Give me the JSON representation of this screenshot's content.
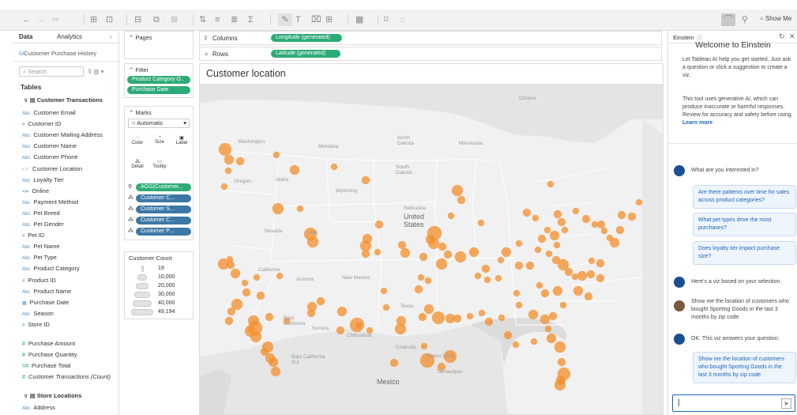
{
  "toolbar": {
    "show_me": "Show Me"
  },
  "data_pane": {
    "tabs": [
      "Data",
      "Analytics"
    ],
    "datasource": "Customer Purchase History",
    "search_placeholder": "Search",
    "tables_heading": "Tables",
    "table1": "Customer Transactions",
    "fields_dim": [
      "Customer Email",
      "Customer ID",
      "Customer Mailing Address",
      "Customer Name",
      "Customer Phone",
      "Customer Location",
      "Loyalty Tier",
      "Online",
      "Payment Method",
      "Pet Breed",
      "Pet Gender",
      "Pet ID",
      "Pet Name",
      "Pet Type",
      "Product Category",
      "Product ID",
      "Product Name",
      "Purchase Date",
      "Season",
      "Store ID"
    ],
    "fields_meas": [
      "Purchase Amount",
      "Purchase Quantity",
      "Purchase Total",
      "Customer Transactions (Count)"
    ],
    "table2": "Store Locations",
    "table2_fields": [
      "Address"
    ]
  },
  "pages": {
    "title": "Pages"
  },
  "filters": {
    "title": "Filter",
    "pills": [
      "Product Category O..",
      "Purchase Date"
    ]
  },
  "marks": {
    "title": "Marks",
    "type": "Automatic",
    "buttons": [
      "Color",
      "Size",
      "Label",
      "Detail",
      "Tooltip"
    ],
    "pills": [
      "AGG(Customer...",
      "Customer C...",
      "Customer S...",
      "Customer C...",
      "Customer P..."
    ]
  },
  "legend": {
    "title": "Customer Count",
    "items": [
      "19",
      "10,000",
      "20,000",
      "30,000",
      "40,000",
      "49,194"
    ]
  },
  "shelves": {
    "columns_label": "Columns",
    "columns_pill": "Longitude (generated)",
    "rows_label": "Rows",
    "rows_pill": "Latitude (generated)"
  },
  "viz": {
    "title": "Customer location",
    "map_labels": {
      "ontario": "Ontario",
      "washington": "Washington",
      "montana": "Montana",
      "north_dakota": "North\nDakota",
      "minnesota": "Minnesota",
      "oregon": "Oregon",
      "idaho": "Idaho",
      "south_dakota": "South\nDakota",
      "wyoming": "Wyoming",
      "nebraska": "Nebraska",
      "nevada": "Nevada",
      "utah": "Utah",
      "united_states": "United\nStates",
      "california": "California",
      "arizona": "Arizona",
      "new_mexico": "New Mexico",
      "texas": "Texas",
      "baja": "Baja\nCalifornia",
      "sonora": "Sonora",
      "chihuahua": "Chihuahua",
      "coahuila": "Coahuila",
      "baja_sur": "Baja California\nSur",
      "mexico": "Mexico",
      "nuevo_leon": "Nuevo Leon",
      "tamaulipas": "Tamaulipas"
    }
  },
  "einstein": {
    "header": "Einstein",
    "welcome": "Welcome to Einstein",
    "intro": "Let Tableau AI help you get started. Just ask a question or click a suggestion to create a viz.",
    "disclaimer": "This tool uses generative AI, which can produce inaccurate or harmful responses. Review for accuracy and safety before using.",
    "learn_more": "Learn more",
    "q1": "What are you interested in?",
    "suggestions": [
      "Are there patterns over time for sales across product categories?",
      "What pet types drive the most purchases?",
      "Does loyalty tier impact purchase size?"
    ],
    "q2": "Here's a viz based on your selection.",
    "user_msg": "Show me the location of customers who bought Sporting Goods in the last 3 months by zip code",
    "ai_msg": "OK. This viz answers your question:",
    "answer_card": "Show me the location of customers who bought Sporting Goods in the last 3 months by zip code",
    "input_placeholder": "|"
  },
  "colors": {
    "accent_green": "#2dab76",
    "pill_blue": "#3c78a6",
    "mark_orange": "#f28e2b",
    "einstein_blue": "#1a66b8"
  }
}
